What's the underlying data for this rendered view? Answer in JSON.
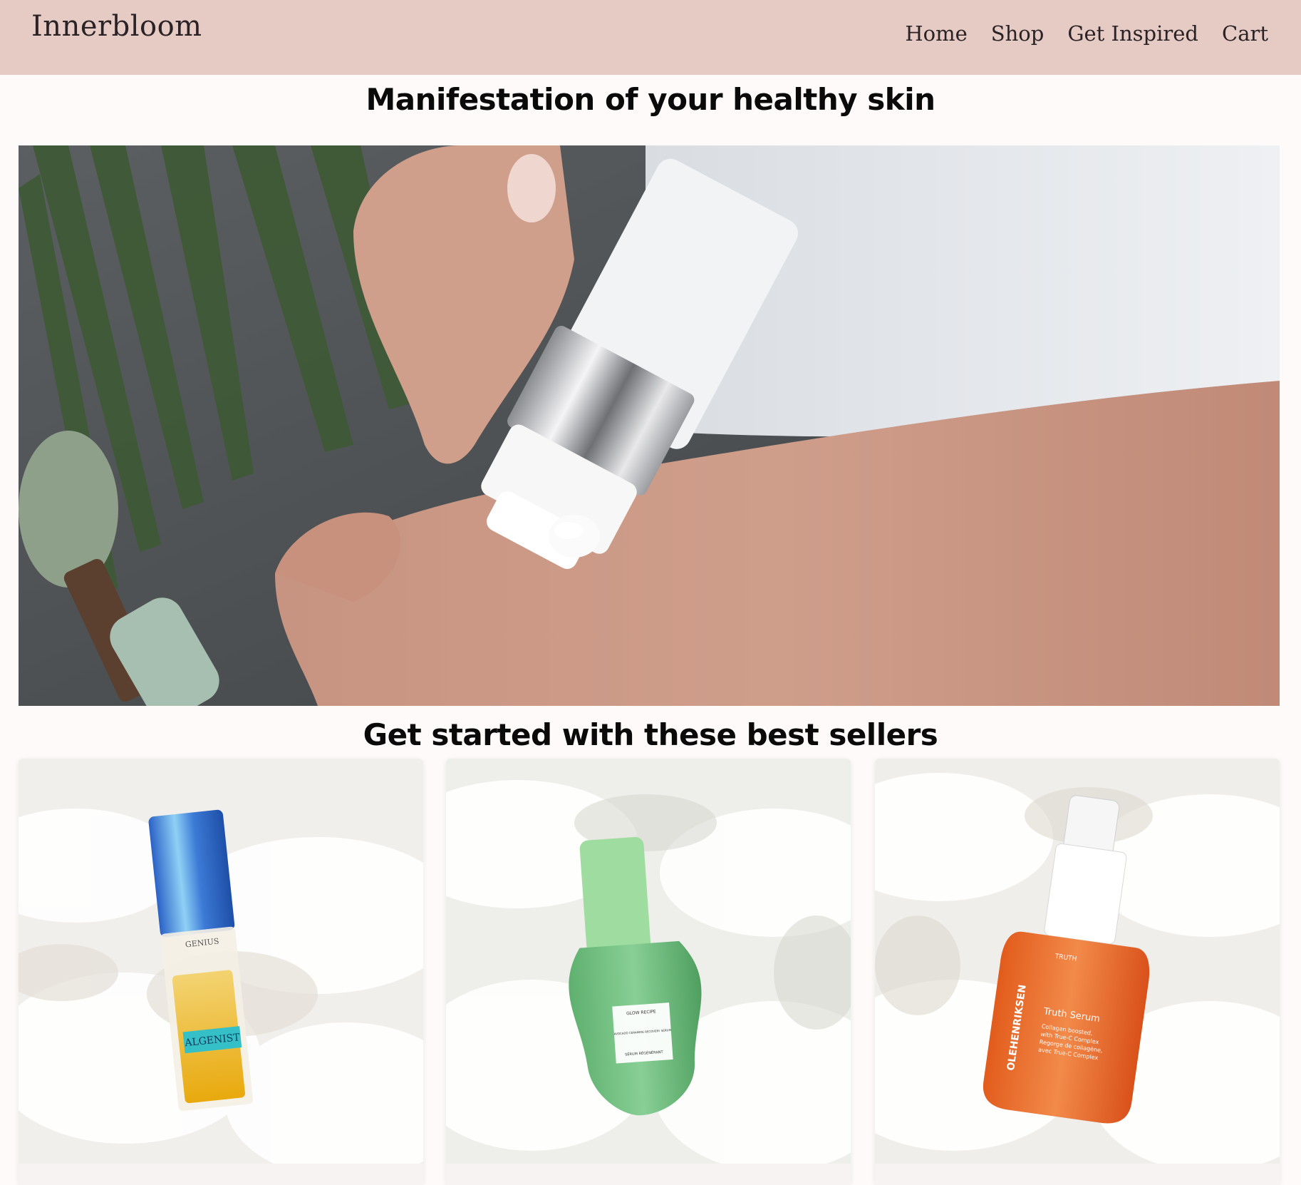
{
  "header": {
    "brand": "Innerbloom",
    "nav": [
      {
        "label": "Home"
      },
      {
        "label": "Shop"
      },
      {
        "label": "Get Inspired"
      },
      {
        "label": "Cart"
      }
    ]
  },
  "hero": {
    "title": "Manifestation of your healthy skin"
  },
  "best_sellers": {
    "title": "Get started with these best sellers",
    "products": [
      {
        "brand": "ALGENIST",
        "product": "GENIUS",
        "color": "#e8b321"
      },
      {
        "brand": "GLOW RECIPE",
        "product": "AVOCADO CERAMIDE RECOVERY SERUM",
        "subtitle": "SÉRUM RÉGÉNÉRANT",
        "color": "#79c28a"
      },
      {
        "brand": "OLEHENRIKSEN",
        "product": "Truth Serum",
        "tag": "TRUTH",
        "lines": [
          "Collagen boosted,",
          "with True-C Complex",
          "Regorge de collagène,",
          "avec True-C Complex"
        ],
        "color": "#ea6a2a"
      }
    ]
  },
  "colors": {
    "header_bg": "#e6cbc5",
    "page_bg": "#fdfaf9",
    "text": "#111111"
  }
}
